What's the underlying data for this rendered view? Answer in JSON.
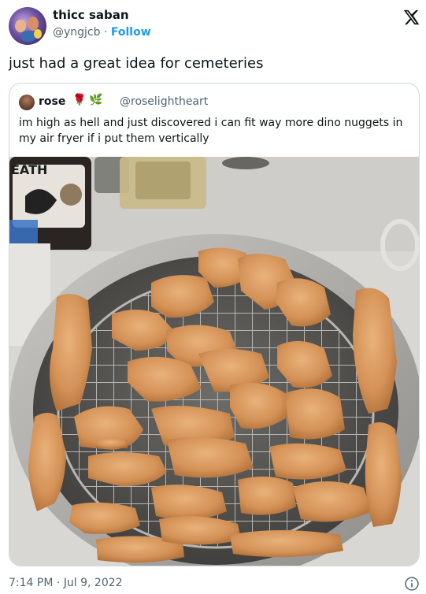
{
  "author": {
    "display_name": "thicc saban",
    "handle": "@yngjcb",
    "separator": "·",
    "follow_label": "Follow"
  },
  "tweet": {
    "text": "just had a great idea for cemeteries",
    "timestamp": "7:14 PM · Jul 9, 2022"
  },
  "quoted_tweet": {
    "display_name": "rose",
    "emoji_1": "🌹",
    "emoji_2": "🌿",
    "handle": "@roselightheart",
    "text": "im high as hell and just discovered i can fit way more dino nuggets in my air fryer if i put them vertically",
    "photo_label_text": "EATH"
  },
  "icons": {
    "platform_logo": "x-logo-icon",
    "info": "info-icon"
  },
  "colors": {
    "follow_blue": "#1d9bf0",
    "secondary_text": "#536471",
    "border": "#cfd9de"
  }
}
